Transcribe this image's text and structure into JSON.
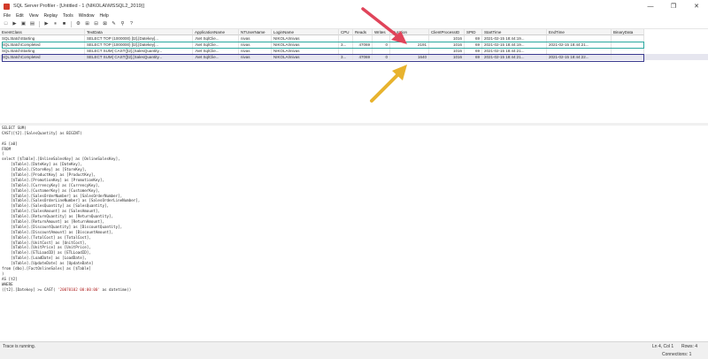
{
  "window": {
    "title": "SQL Server Profiler - [Untitled - 1 (NIKOLAI\\MSSQL2_2019)]",
    "controls": [
      "—",
      "❐",
      "✕"
    ]
  },
  "menu": [
    "File",
    "Edit",
    "View",
    "Replay",
    "Tools",
    "Window",
    "Help"
  ],
  "toolbar": {
    "buttons": [
      "□",
      "▶",
      "▣",
      "▤",
      "▶",
      "⏸",
      "■",
      "⚙",
      "⊞",
      "⊟",
      "⊠",
      "✎",
      "⚲",
      "?"
    ]
  },
  "grid": {
    "columns": [
      "EventClass",
      "TextData",
      "ApplicationName",
      "NTUserName",
      "LoginName",
      "CPU",
      "Reads",
      "Writes",
      "Duration",
      "ClientProcessID",
      "SPID",
      "StartTime",
      "EndTime",
      "BinaryData"
    ],
    "rows": [
      [
        "SQL:BatchStarting",
        "SELECT TOP (1000000) [t2].[Datekey]...",
        ".Net SqlClie...",
        "nivas",
        "NIKOLAI\\nivas",
        "",
        "",
        "",
        "",
        "1016",
        "69",
        "2021-02-15 18:44:19...",
        "",
        ""
      ],
      [
        "SQL:BatchCompleted",
        "SELECT TOP (1000000) [t2].[Datekey]...",
        ".Net SqlClie...",
        "nivas",
        "NIKOLAI\\nivas",
        "3...",
        "47069",
        "0",
        "2191",
        "1016",
        "69",
        "2021-02-15 18:44:19...",
        "2021-02-15 18:44:21...",
        ""
      ],
      [
        "SQL:BatchStarting",
        "SELECT SUM( CAST([t2].[SalesQuantity...",
        ".Net SqlClie...",
        "nivas",
        "NIKOLAI\\nivas",
        "",
        "",
        "",
        "",
        "1016",
        "69",
        "2021-02-15 18:44:21...",
        "",
        ""
      ],
      [
        "SQL:BatchCompleted",
        "SELECT SUM( CAST([t2].[SalesQuantity...",
        ".Net SqlClie...",
        "nivas",
        "NIKOLAI\\nivas",
        "3...",
        "47069",
        "0",
        "1640",
        "1016",
        "69",
        "2021-02-15 18:44:21...",
        "2021-02-15 18:44:22...",
        ""
      ]
    ]
  },
  "sql_text": [
    "SELECT SUM(",
    "CAST([t2].[SalesQuantity] as BIGINT)",
    "",
    "AS [a0]",
    "FROM",
    "(",
    "select [$Table].[OnlineSalesKey] as [OnlineSalesKey],",
    "    [$Table].[DateKey] as [DateKey],",
    "    [$Table].[StoreKey] as [StoreKey],",
    "    [$Table].[ProductKey] as [ProductKey],",
    "    [$Table].[PromotionKey] as [PromotionKey],",
    "    [$Table].[CurrencyKey] as [CurrencyKey],",
    "    [$Table].[CustomerKey] as [CustomerKey],",
    "    [$Table].[SalesOrderNumber] as [SalesOrderNumber],",
    "    [$Table].[SalesOrderLineNumber] as [SalesOrderLineNumber],",
    "    [$Table].[SalesQuantity] as [SalesQuantity],",
    "    [$Table].[SalesAmount] as [SalesAmount],",
    "    [$Table].[ReturnQuantity] as [ReturnQuantity],",
    "    [$Table].[ReturnAmount] as [ReturnAmount],",
    "    [$Table].[DiscountQuantity] as [DiscountQuantity],",
    "    [$Table].[DiscountAmount] as [DiscountAmount],",
    "    [$Table].[TotalCost] as [TotalCost],",
    "    [$Table].[UnitCost] as [UnitCost],",
    "    [$Table].[UnitPrice] as [UnitPrice],",
    "    [$Table].[ETLLoadID] as [ETLLoadID],",
    "    [$Table].[LoadDate] as [LoadDate],",
    "    [$Table].[UpdateDate] as [UpdateDate]",
    "from [dbo].[FactOnlineSales] as [$Table]",
    ")",
    "AS [t2]",
    "WHERE",
    "([t2].[Datekey] >= CAST( '20070102 00:00:00' as datetime))"
  ],
  "status": {
    "left": "Trace is running.",
    "position": "Ln 4, Col 1",
    "rows": "Rows: 4",
    "connections": "Connections: 1"
  },
  "colors": {
    "teal_highlight": "#2aa79f",
    "navy_highlight": "#3b3b8f",
    "red_arrow": "#e0445a",
    "gold_arrow": "#e8b32e"
  }
}
